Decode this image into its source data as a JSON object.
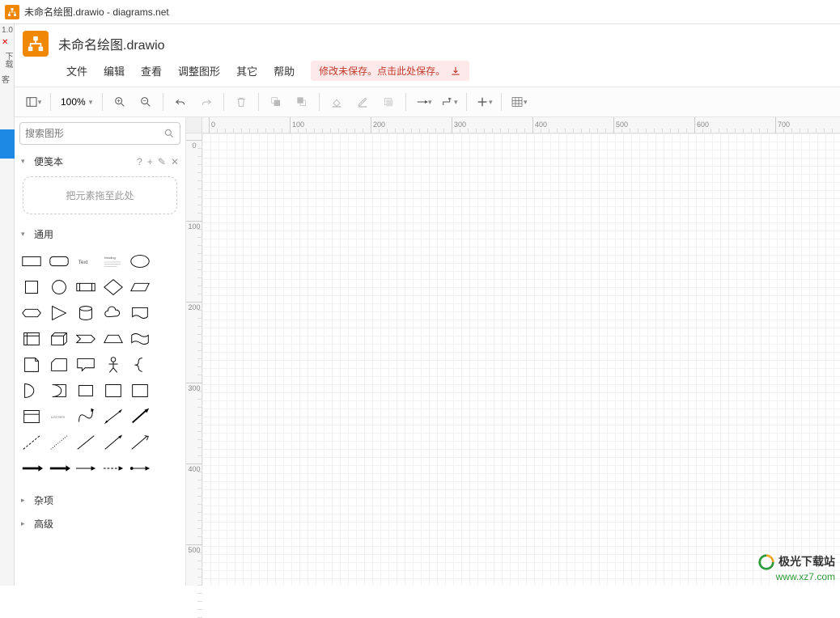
{
  "window_title": "未命名绘图.drawio - diagrams.net",
  "left_strip": {
    "version": "1.0",
    "dl_label": "下载",
    "clip_label": "客"
  },
  "header": {
    "doc_title": "未命名绘图.drawio"
  },
  "menu": {
    "file": "文件",
    "edit": "编辑",
    "view": "查看",
    "arrange": "调整图形",
    "extras": "其它",
    "help": "帮助"
  },
  "banner": {
    "text": "修改未保存。点击此处保存。"
  },
  "toolbar": {
    "zoom_value": "100%"
  },
  "sidebar": {
    "search_placeholder": "搜索图形",
    "scratchpad_title": "便笺本",
    "scratchpad_help": "?",
    "scratchpad_drop": "把元素拖至此处",
    "general_title": "通用",
    "misc_title": "杂项",
    "advanced_title": "高级"
  },
  "ruler_ticks_h": [
    "0",
    "100",
    "200",
    "300",
    "400",
    "500",
    "600",
    "700"
  ],
  "ruler_ticks_v": [
    "0",
    "100",
    "200",
    "300",
    "400",
    "500"
  ],
  "watermark": {
    "brand": "极光下载站",
    "url": "www.xz7.com"
  }
}
